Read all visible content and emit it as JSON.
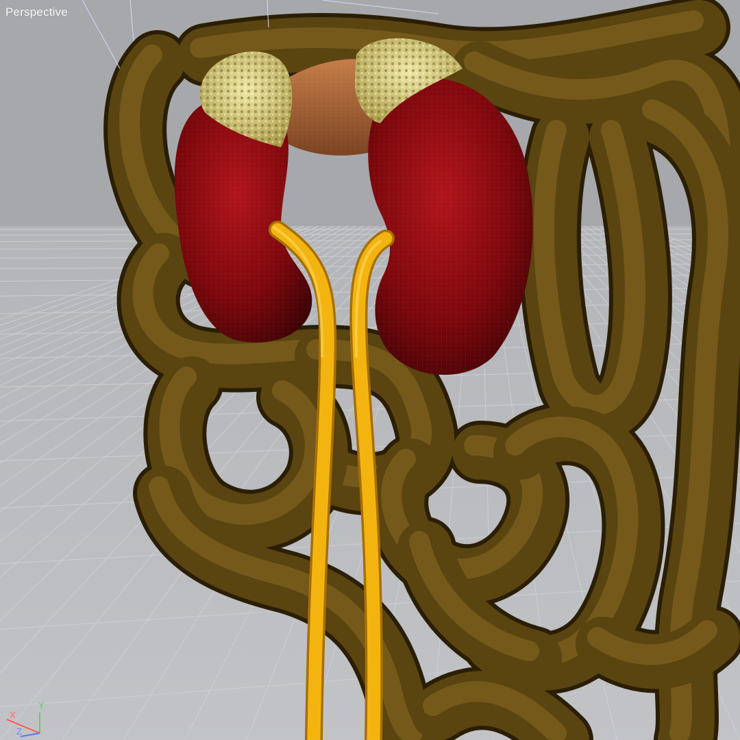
{
  "viewport": {
    "label": "Perspective",
    "background_color": "#a6a8ab",
    "grid_color": "#c9cacd",
    "gizmo_axes": [
      "X",
      "Y",
      "Z"
    ]
  },
  "scene": {
    "objects": [
      {
        "name": "intestines",
        "color": "#5a4410"
      },
      {
        "name": "left-kidney",
        "color": "#8a0a0e"
      },
      {
        "name": "right-kidney",
        "color": "#8a0a0e"
      },
      {
        "name": "left-adrenal-gland",
        "color": "#d9d28a"
      },
      {
        "name": "right-adrenal-gland",
        "color": "#d9d28a"
      },
      {
        "name": "renal-vessel-bridge",
        "color": "#b06a3a"
      },
      {
        "name": "left-ureter",
        "color": "#f2b00e"
      },
      {
        "name": "right-ureter",
        "color": "#f2b00e"
      }
    ]
  }
}
